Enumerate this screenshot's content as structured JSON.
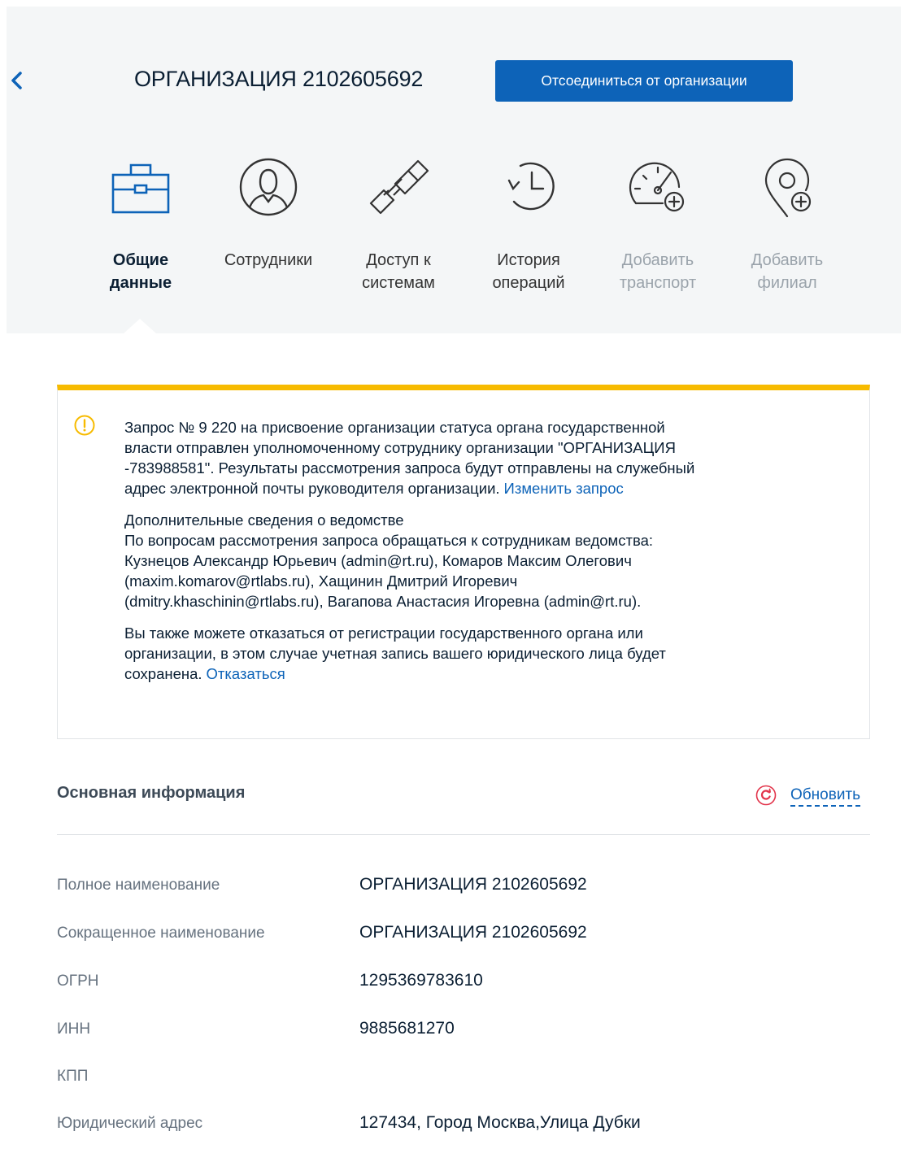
{
  "header": {
    "title": "ОРГАНИЗАЦИЯ 2102605692",
    "disconnect_label": "Отсоединиться от организации"
  },
  "nav": {
    "tabs": [
      {
        "label_line1": "Общие",
        "label_line2": "данные",
        "icon": "briefcase-icon",
        "state": "active"
      },
      {
        "label_line1": "Сотрудники",
        "label_line2": "",
        "icon": "user-icon",
        "state": "normal"
      },
      {
        "label_line1": "Доступ к",
        "label_line2": "системам",
        "icon": "chain-link-icon",
        "state": "normal"
      },
      {
        "label_line1": "История",
        "label_line2": "операций",
        "icon": "history-icon",
        "state": "normal"
      },
      {
        "label_line1": "Добавить",
        "label_line2": "транспорт",
        "icon": "speedometer-add-icon",
        "state": "disabled"
      },
      {
        "label_line1": "Добавить",
        "label_line2": "филиал",
        "icon": "location-add-icon",
        "state": "disabled"
      }
    ]
  },
  "alert": {
    "p1_line1": "Запрос № 9 220 на присвоение организации статуса органа государственной",
    "p1_line2": "власти отправлен уполномоченному сотруднику организации \"ОРГАНИЗАЦИЯ",
    "p1_line3": "-783988581\". Результаты рассмотрения запроса будут отправлены на служебный",
    "p1_line4": "адрес электронной почты руководителя организации.",
    "change_request_link": "Изменить запрос",
    "p2_line1": "Дополнительные сведения о ведомстве",
    "p2_line2": "По вопросам рассмотрения запроса обращаться к сотрудникам ведомства:",
    "p2_line3": "Кузнецов Александр Юрьевич (admin@rt.ru), Комаров Максим Олегович",
    "p2_line4": "(maxim.komarov@rtlabs.ru), Хащинин Дмитрий Игоревич",
    "p2_line5": "(dmitry.khaschinin@rtlabs.ru), Вагапова Анастасия Игоревна (admin@rt.ru).",
    "p3_line1": "Вы также можете отказаться от регистрации государственного органа или",
    "p3_line2": "организации, в этом случае учетная запись вашего юридического лица будет",
    "p3_line3": "сохранена.",
    "decline_link": "Отказаться",
    "accent_color": "#f7bb00"
  },
  "basic_info": {
    "title": "Основная информация",
    "refresh_label": "Обновить",
    "rows": [
      {
        "label": "Полное наименование",
        "value": "ОРГАНИЗАЦИЯ 2102605692"
      },
      {
        "label": "Сокращенное наименование",
        "value": "ОРГАНИЗАЦИЯ 2102605692"
      },
      {
        "label": "ОГРН",
        "value": "1295369783610"
      },
      {
        "label": "ИНН",
        "value": "9885681270"
      },
      {
        "label": "КПП",
        "value": ""
      },
      {
        "label": "Юридический адрес",
        "value": "127434, Город Москва,Улица Дубки"
      }
    ]
  },
  "colors": {
    "primary": "#0d63b8",
    "header_bg": "#f4f6f7",
    "warning": "#f7bb00",
    "refresh_icon": "#e2334a"
  }
}
